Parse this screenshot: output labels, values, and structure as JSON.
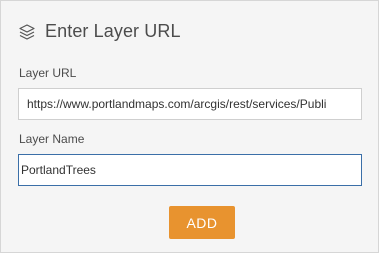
{
  "header": {
    "title": "Enter Layer URL",
    "icon": "layers-icon"
  },
  "form": {
    "url_label": "Layer URL",
    "url_value": "https://www.portlandmaps.com/arcgis/rest/services/Publi",
    "name_label": "Layer Name",
    "name_value": "PortlandTrees",
    "add_label": "ADD"
  },
  "colors": {
    "panel_bg": "#f5f5f5",
    "accent": "#e8932f",
    "focus_border": "#3b6fa8",
    "text": "#4c4c4c"
  }
}
